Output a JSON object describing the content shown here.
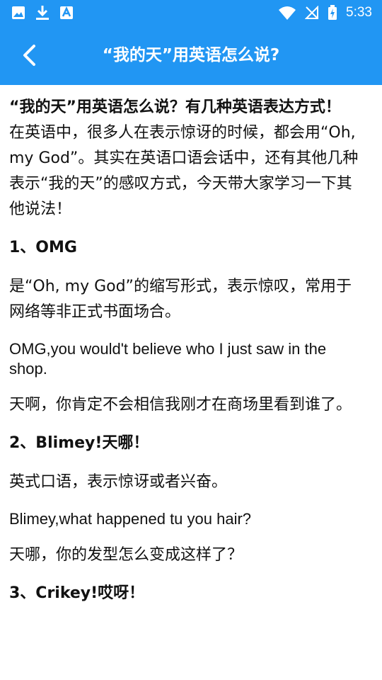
{
  "status_bar": {
    "time": "5:33",
    "icons": [
      "gallery-icon",
      "download-icon",
      "font-app-icon",
      "wifi-icon",
      "no-signal-icon",
      "battery-charging-icon"
    ]
  },
  "toolbar": {
    "title": "“我的天”用英语怎么说?"
  },
  "article": {
    "intro_title": "“我的天”用英语怎么说？有几种英语表达方式！",
    "intro_body": "在英语中，很多人在表示惊讶的时候，都会用“Oh, my God”。其实在英语口语会话中，还有其他几种表示“我的天”的感叹方式，今天带大家学习一下其他说法！",
    "sections": [
      {
        "heading": "1、OMG",
        "desc": "是“Oh, my God”的缩写形式，表示惊叹，常用于网络等非正式书面场合。",
        "example_en": "OMG,you would't believe who I just saw in the shop.",
        "example_zh": "天啊，你肯定不会相信我刚才在商场里看到谁了。"
      },
      {
        "heading": "2、Blimey!天哪！",
        "desc": "英式口语，表示惊讶或者兴奋。",
        "example_en": "Blimey,what happened tu you hair?",
        "example_zh": "天哪，你的发型怎么变成这样了？"
      },
      {
        "heading": "3、Crikey!哎呀！"
      }
    ]
  }
}
